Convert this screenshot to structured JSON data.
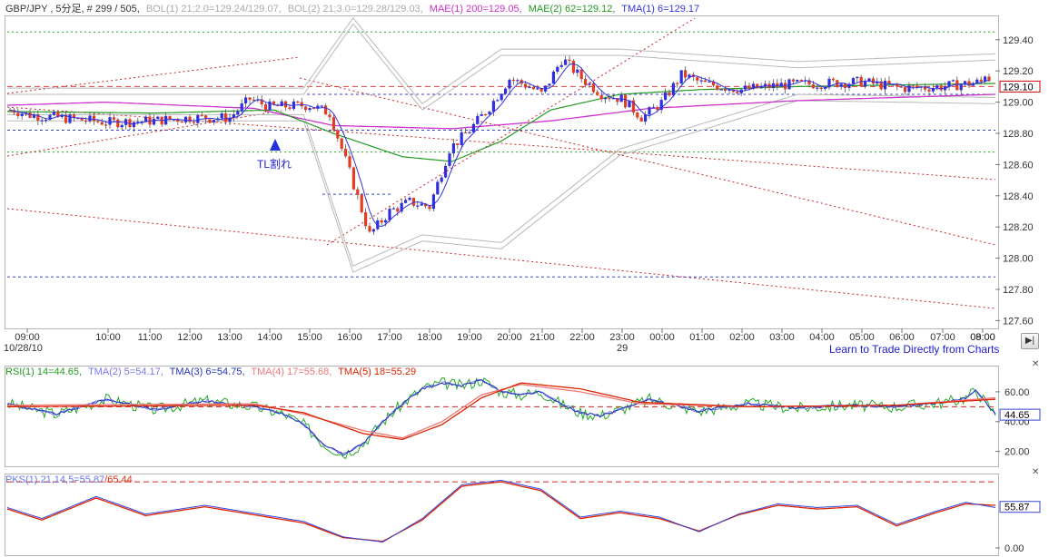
{
  "main_header": {
    "symbol": "GBP/JPY , 5分足, # 299 / 505,",
    "bol1": "BOL(1) 21;2.0=129.24/129.07,",
    "bol2": "BOL(2) 21;3.0=129.28/129.03,",
    "mae1": "MAE(1) 200=129.05,",
    "mae2": "MAE(2) 62=129.12,",
    "tma1": "TMA(1) 6=129.17"
  },
  "colors": {
    "up_candle": "#2f2fe0",
    "down_candle": "#e53b20",
    "mae1": "#cc33cc",
    "mae2": "#229922",
    "tma1": "#3333dd",
    "bollinger": "#b8b8b8",
    "rsi": "#22aa22",
    "tma2": "#7777ee",
    "tma3": "#2233bb",
    "tma4": "#ee7777",
    "tma5": "#dd2200",
    "pks_fast": "#3344dd",
    "pks_slow": "#dd2200",
    "price_tag_border": "#cc0000"
  },
  "annotation": {
    "text": "TL割れ",
    "icon": "up-triangle-icon"
  },
  "x_axis": {
    "time_labels": [
      "09:00",
      "10:00",
      "11:00",
      "12:00",
      "13:00",
      "14:00",
      "15:00",
      "16:00",
      "17:00",
      "18:00",
      "19:00",
      "20:00",
      "21:00",
      "22:00",
      "23:00",
      "00:00",
      "01:00",
      "02:00",
      "03:00",
      "04:00",
      "05:00",
      "06:00",
      "07:00",
      "08:00",
      "09:00"
    ],
    "date_label": "10/28/10",
    "day_label": "29"
  },
  "learn_link": "Learn to Trade Directly from Charts",
  "nav_button": {
    "icon": "play-end-icon"
  },
  "rsi_header": {
    "rsi": "RSI(1) 14=44.65,",
    "tma2": "TMA(2) 5=54.17,",
    "tma3": "TMA(3) 6=54.75,",
    "tma4": "TMA(4) 17=55.68,",
    "tma5": "TMA(5) 18=55.29"
  },
  "pks_header": {
    "fast": "PKS(1) 21,14,5=55.87",
    "slow": "/65.44"
  },
  "chart_data": [
    {
      "type": "candlestick",
      "title": "GBP/JPY , 5分足",
      "y_ticks": [
        "129.40",
        "129.20",
        "129.00",
        "128.80",
        "128.60",
        "128.40",
        "128.20",
        "128.00",
        "127.80",
        "127.60"
      ],
      "ylim": [
        127.55,
        129.55
      ],
      "price_tag": "129.10",
      "ohlc_anchors": [
        {
          "time": "08:30",
          "price": 128.95
        },
        {
          "time": "09:00",
          "price": 128.92
        },
        {
          "time": "10:00",
          "price": 128.87
        },
        {
          "time": "11:00",
          "price": 128.88
        },
        {
          "time": "12:00",
          "price": 128.9
        },
        {
          "time": "13:00",
          "price": 128.9
        },
        {
          "time": "13:30",
          "price": 129.02
        },
        {
          "time": "14:00",
          "price": 128.97
        },
        {
          "time": "15:00",
          "price": 128.98
        },
        {
          "time": "15:30",
          "price": 128.93
        },
        {
          "time": "16:00",
          "price": 128.55
        },
        {
          "time": "16:30",
          "price": 128.15
        },
        {
          "time": "17:00",
          "price": 128.3
        },
        {
          "time": "17:30",
          "price": 128.36
        },
        {
          "time": "18:00",
          "price": 128.33
        },
        {
          "time": "18:30",
          "price": 128.7
        },
        {
          "time": "19:00",
          "price": 128.82
        },
        {
          "time": "19:30",
          "price": 128.97
        },
        {
          "time": "20:00",
          "price": 129.15
        },
        {
          "time": "20:30",
          "price": 129.1
        },
        {
          "time": "21:00",
          "price": 129.05
        },
        {
          "time": "21:30",
          "price": 129.28
        },
        {
          "time": "22:00",
          "price": 129.15
        },
        {
          "time": "22:30",
          "price": 129.05
        },
        {
          "time": "23:00",
          "price": 129.02
        },
        {
          "time": "23:30",
          "price": 128.9
        },
        {
          "time": "00:00",
          "price": 129.0
        },
        {
          "time": "00:30",
          "price": 129.18
        },
        {
          "time": "01:00",
          "price": 129.12
        },
        {
          "time": "01:30",
          "price": 129.1
        },
        {
          "time": "02:00",
          "price": 129.08
        },
        {
          "time": "03:00",
          "price": 129.11
        },
        {
          "time": "04:00",
          "price": 129.12
        },
        {
          "time": "05:00",
          "price": 129.13
        },
        {
          "time": "06:00",
          "price": 129.09
        },
        {
          "time": "07:00",
          "price": 129.1
        },
        {
          "time": "08:00",
          "price": 129.13
        },
        {
          "time": "09:00",
          "price": 129.2
        },
        {
          "time": "09:20",
          "price": 129.1
        }
      ],
      "series": [
        {
          "name": "MAE(1) 200",
          "anchors": [
            [
              0,
              128.98
            ],
            [
              0.1,
              129.0
            ],
            [
              0.25,
              128.96
            ],
            [
              0.33,
              128.85
            ],
            [
              0.45,
              128.83
            ],
            [
              0.55,
              128.88
            ],
            [
              0.65,
              128.96
            ],
            [
              0.8,
              129.01
            ],
            [
              1,
              129.05
            ]
          ]
        },
        {
          "name": "MAE(2) 62",
          "anchors": [
            [
              0,
              128.94
            ],
            [
              0.15,
              128.93
            ],
            [
              0.27,
              128.95
            ],
            [
              0.33,
              128.8
            ],
            [
              0.4,
              128.65
            ],
            [
              0.45,
              128.62
            ],
            [
              0.5,
              128.75
            ],
            [
              0.55,
              128.95
            ],
            [
              0.62,
              129.05
            ],
            [
              0.7,
              129.08
            ],
            [
              0.8,
              129.1
            ],
            [
              1,
              129.12
            ]
          ]
        }
      ],
      "bollinger": {
        "upper": [
          [
            0.3,
            129.05
          ],
          [
            0.35,
            129.5
          ],
          [
            0.42,
            128.95
          ],
          [
            0.5,
            129.3
          ],
          [
            0.62,
            129.3
          ],
          [
            0.8,
            129.22
          ],
          [
            1,
            129.27
          ]
        ],
        "lower": [
          [
            0.3,
            128.92
          ],
          [
            0.35,
            127.95
          ],
          [
            0.42,
            128.15
          ],
          [
            0.5,
            128.1
          ],
          [
            0.62,
            128.7
          ],
          [
            0.8,
            129.05
          ],
          [
            1,
            129.03
          ]
        ]
      },
      "h_lines": [
        129.45,
        128.68,
        129.1,
        128.82,
        127.88
      ]
    },
    {
      "type": "line",
      "title": "RSI(1) 14",
      "y_ticks": [
        "60.00",
        "40.00",
        "20.00"
      ],
      "ylim": [
        10,
        77
      ],
      "current": "44.65",
      "ref_line": 50,
      "rsi_anchors": [
        [
          0,
          52
        ],
        [
          0.05,
          45
        ],
        [
          0.1,
          55
        ],
        [
          0.15,
          48
        ],
        [
          0.2,
          54
        ],
        [
          0.25,
          50
        ],
        [
          0.28,
          45
        ],
        [
          0.3,
          38
        ],
        [
          0.32,
          25
        ],
        [
          0.34,
          18
        ],
        [
          0.36,
          25
        ],
        [
          0.38,
          40
        ],
        [
          0.4,
          52
        ],
        [
          0.42,
          62
        ],
        [
          0.44,
          66
        ],
        [
          0.46,
          64
        ],
        [
          0.48,
          68
        ],
        [
          0.5,
          60
        ],
        [
          0.52,
          58
        ],
        [
          0.54,
          60
        ],
        [
          0.56,
          52
        ],
        [
          0.58,
          46
        ],
        [
          0.6,
          44
        ],
        [
          0.62,
          48
        ],
        [
          0.65,
          55
        ],
        [
          0.7,
          47
        ],
        [
          0.75,
          52
        ],
        [
          0.8,
          49
        ],
        [
          0.85,
          51
        ],
        [
          0.9,
          50
        ],
        [
          0.95,
          53
        ],
        [
          0.97,
          56
        ],
        [
          0.98,
          61
        ],
        [
          1,
          45
        ]
      ],
      "tma4_anchors": [
        [
          0,
          51
        ],
        [
          0.25,
          52
        ],
        [
          0.3,
          45
        ],
        [
          0.36,
          34
        ],
        [
          0.4,
          29
        ],
        [
          0.44,
          40
        ],
        [
          0.48,
          58
        ],
        [
          0.52,
          65
        ],
        [
          0.58,
          60
        ],
        [
          0.64,
          52
        ],
        [
          0.75,
          50
        ],
        [
          0.9,
          51
        ],
        [
          1,
          56
        ]
      ],
      "tma5_anchors": [
        [
          0,
          50
        ],
        [
          0.25,
          51
        ],
        [
          0.3,
          46
        ],
        [
          0.36,
          32
        ],
        [
          0.4,
          28
        ],
        [
          0.44,
          38
        ],
        [
          0.48,
          56
        ],
        [
          0.52,
          66
        ],
        [
          0.58,
          62
        ],
        [
          0.64,
          53
        ],
        [
          0.75,
          50
        ],
        [
          0.9,
          51
        ],
        [
          1,
          55
        ]
      ]
    },
    {
      "type": "line",
      "title": "PKS(1) 21,14,5",
      "y_ticks": [
        "0.00"
      ],
      "ylim": [
        0,
        100
      ],
      "current": "55.87",
      "ref_line": 90,
      "fast_anchors": [
        [
          0,
          55
        ],
        [
          0.035,
          40
        ],
        [
          0.09,
          70
        ],
        [
          0.14,
          46
        ],
        [
          0.2,
          58
        ],
        [
          0.25,
          47
        ],
        [
          0.3,
          36
        ],
        [
          0.34,
          15
        ],
        [
          0.38,
          8
        ],
        [
          0.42,
          40
        ],
        [
          0.46,
          86
        ],
        [
          0.5,
          92
        ],
        [
          0.54,
          80
        ],
        [
          0.58,
          42
        ],
        [
          0.62,
          50
        ],
        [
          0.66,
          42
        ],
        [
          0.7,
          22
        ],
        [
          0.74,
          46
        ],
        [
          0.78,
          60
        ],
        [
          0.82,
          55
        ],
        [
          0.86,
          58
        ],
        [
          0.9,
          32
        ],
        [
          0.94,
          50
        ],
        [
          0.97,
          62
        ],
        [
          1,
          55
        ]
      ],
      "slow_anchors": [
        [
          0,
          53
        ],
        [
          0.035,
          38
        ],
        [
          0.09,
          68
        ],
        [
          0.14,
          44
        ],
        [
          0.2,
          56
        ],
        [
          0.25,
          45
        ],
        [
          0.3,
          34
        ],
        [
          0.34,
          14
        ],
        [
          0.38,
          9
        ],
        [
          0.42,
          38
        ],
        [
          0.46,
          84
        ],
        [
          0.5,
          90
        ],
        [
          0.54,
          78
        ],
        [
          0.58,
          40
        ],
        [
          0.62,
          48
        ],
        [
          0.66,
          40
        ],
        [
          0.7,
          23
        ],
        [
          0.74,
          45
        ],
        [
          0.78,
          58
        ],
        [
          0.82,
          53
        ],
        [
          0.86,
          56
        ],
        [
          0.9,
          30
        ],
        [
          0.94,
          48
        ],
        [
          0.97,
          60
        ],
        [
          1,
          58
        ]
      ]
    }
  ]
}
